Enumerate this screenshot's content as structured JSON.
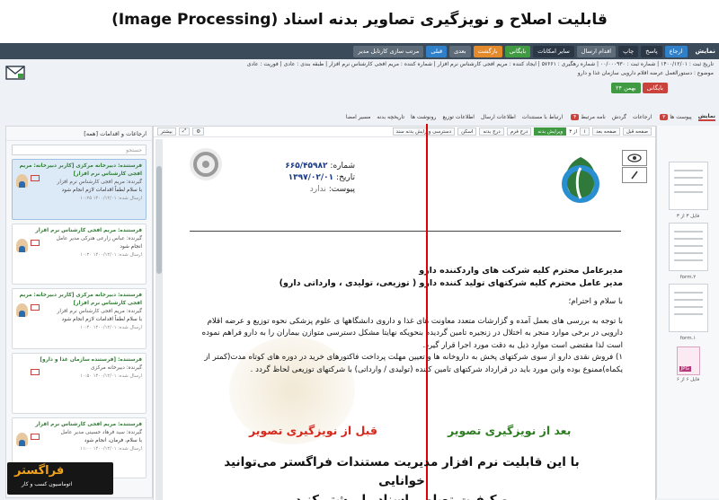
{
  "banner": {
    "title": "قابلیت اصلاح و نویزگیری تصاویر بدنه اسناد (Image Processing)"
  },
  "topbar": {
    "title": "نمایش",
    "buttons": [
      "ارجاع",
      "پاسخ",
      "چاپ",
      "اقدام ارسال",
      "بایگانی",
      "بازگشت",
      "بعدی",
      "قبلی",
      "مرتب سازی کارتابل مدیر"
    ],
    "select_label": "سایر امکانات"
  },
  "meta": {
    "line1": "تاریخ ثبت : ۱۴۰۰/۱۲/۰۱ | شماره ثبت : ۰۰/۰۰۰۹۳۰ | شماره رهگیری : ۵۷۶۶۱ | ایجاد کننده : مریم افجی کارشناس نرم افزار | شماره کننده : مریم افجی کارشناس نرم افزار | طبقه بندی : عادی | فوریت : عادی",
    "line2": "موضوع : دستورالعمل عرضه اقلام دارویی سازمان غذا و دارو"
  },
  "tags": [
    {
      "label": "بایگانی",
      "color": "#c9423c"
    },
    {
      "label": "۲۴ بهمن",
      "color": "#3f9a42"
    }
  ],
  "tabs": {
    "items": [
      "نمایش",
      "پیوست ها",
      "ارجاعات",
      "گردش",
      "نامه مرتبط",
      "ارتباط با مستندات",
      "اطلاعات ارسال",
      "اطلاعات توزیع",
      "رونوشت ها",
      "تاریخچه بدنه",
      "مسیر امضا"
    ],
    "badge1": "۳",
    "badge2": "۴"
  },
  "leftpanel": {
    "header": "ارجاعات و اقدامات [همه]",
    "search_placeholder": "جستجو",
    "messages": [
      {
        "from": "فرستنده: دبیرخانه مرکزی [کاربر دبیرخانه: مریم افجی کارشناس نرم افزار]",
        "to": "گیرنده: مریم افجی کارشناس نرم افزار",
        "body": "با سلام لطفاً اقدامات لازم انجام شود",
        "date": "ارسال شده: ۱۴۰۰/۱۲/۰۱ ۱۰:۲۵"
      },
      {
        "from": "فرستنده: مریم افجی کارشناس نرم افزار",
        "to": "گیرنده: عباس زارعی هنرکی مدیر عامل",
        "body": "انجام شود",
        "date": "ارسال شده: ۱۴۰۰/۱۲/۰۱ ۱۰:۳۰"
      },
      {
        "from": "فرستنده: دبیرخانه مرکزی [کاربر دبیرخانه: مریم افجی کارشناس نرم افزار]",
        "to": "گیرنده: مریم افجی کارشناس نرم افزار",
        "body": "با سلام لطفاً اقدامات لازم انجام شود",
        "date": "ارسال شده: ۱۴۰۰/۱۲/۰۱ ۱۰:۴۰"
      },
      {
        "from": "فرستنده: [فرستنده سازمان غذا و دارو]",
        "to": "گیرنده: دبیرخانه مرکزی",
        "body": "",
        "date": "ارسال شده: ۱۴۰۰/۱۲/۰۱ ۱۰:۵۰"
      },
      {
        "from": "فرستنده: مریم افجی کارشناس نرم افزار",
        "to": "گیرنده: سید فرهاد حسینی مدیر عامل",
        "body": "با سلام، فرمان، انجام شود",
        "date": "ارسال شده: ۱۴۰۰/۱۲/۰۱ ۱۱:۰۰"
      }
    ]
  },
  "rightpanel": {
    "files": [
      {
        "caption": "فایل ۳ از ۳"
      },
      {
        "caption": "form.۲"
      },
      {
        "caption": "form.۱"
      }
    ],
    "jpg_label": "JPG",
    "jpg_caption": "فایل ۶ از ۶"
  },
  "viewer": {
    "toolbar": [
      "صفحه قبل",
      "صفحه بعد",
      "۱",
      "از ۳",
      "ویرایش بدنه",
      "درج فرم",
      "درج بدنه",
      "اسکن",
      "دسترسی ویرایش بدنه سند"
    ],
    "more_label": "بیشتر"
  },
  "document": {
    "num_label": "شماره:",
    "num_value": "۶۶۵/۴۵۹۸۲",
    "date_label": "تاریخ:",
    "date_value": "۱۳۹۷/۰۲/۰۱",
    "attach_label": "پیوست:",
    "attach_value": "ندارد",
    "heading1": "مدیرعامل محترم کلیه شرکت های واردکننده دارو",
    "heading2": "مدیر عامل محترم کلیه شرکتهای تولید کننده دارو ( توزیعی، تولیدی ، وارداتی دارو)",
    "greeting": "با سلام و احترام؛",
    "para1": "با توجه به بررسی های بعمل آمده و گزارشات متعدد معاونت های غذا و داروی دانشگاهها ی علوم پزشکی نحوه توزیع و عرضه اقلام دارویی در برخی موارد منجر به اختلال در زنجیره تامین گردیده بنحویکه نهایتا مشکل دسترسی متوازن بیماران را به دارو فراهم نموده است لذا مقتضی است موارد ذیل به دقت مورد اجرا قرار گیرد.",
    "para2": "۱) فروش نقدی دارو از سوی شرکتهای پخش به داروخانه ها و تعیین مهلت پرداخت فاکتورهای خرید در دوره های کوتاه مدت(کمتر از یکماه)ممنوع بوده واین مورد باید در قرارداد شرکتهای تامین کننده (تولیدی / وارداتی) با شرکتهای توزیعی لحاظ گردد ."
  },
  "labels": {
    "before": "قبل از نویزگیری تصویر",
    "after": "بعد از نویزگیری تصویر"
  },
  "caption": {
    "line1": "با این قابلیت نرم افزار مدیریت مستندات فراگستر می‌توانید خوانایی",
    "line2": "و کیفیت تصاویر اسناد را بیشتر کنید"
  },
  "brand": {
    "name": "فراگستر",
    "tagline": "اتوماسیون کسب و کار"
  },
  "colors": {
    "red_line": "#e00000",
    "before_label": "#d6281c",
    "after_label": "#2e7d22",
    "brand_orange": "#f2a31b"
  }
}
